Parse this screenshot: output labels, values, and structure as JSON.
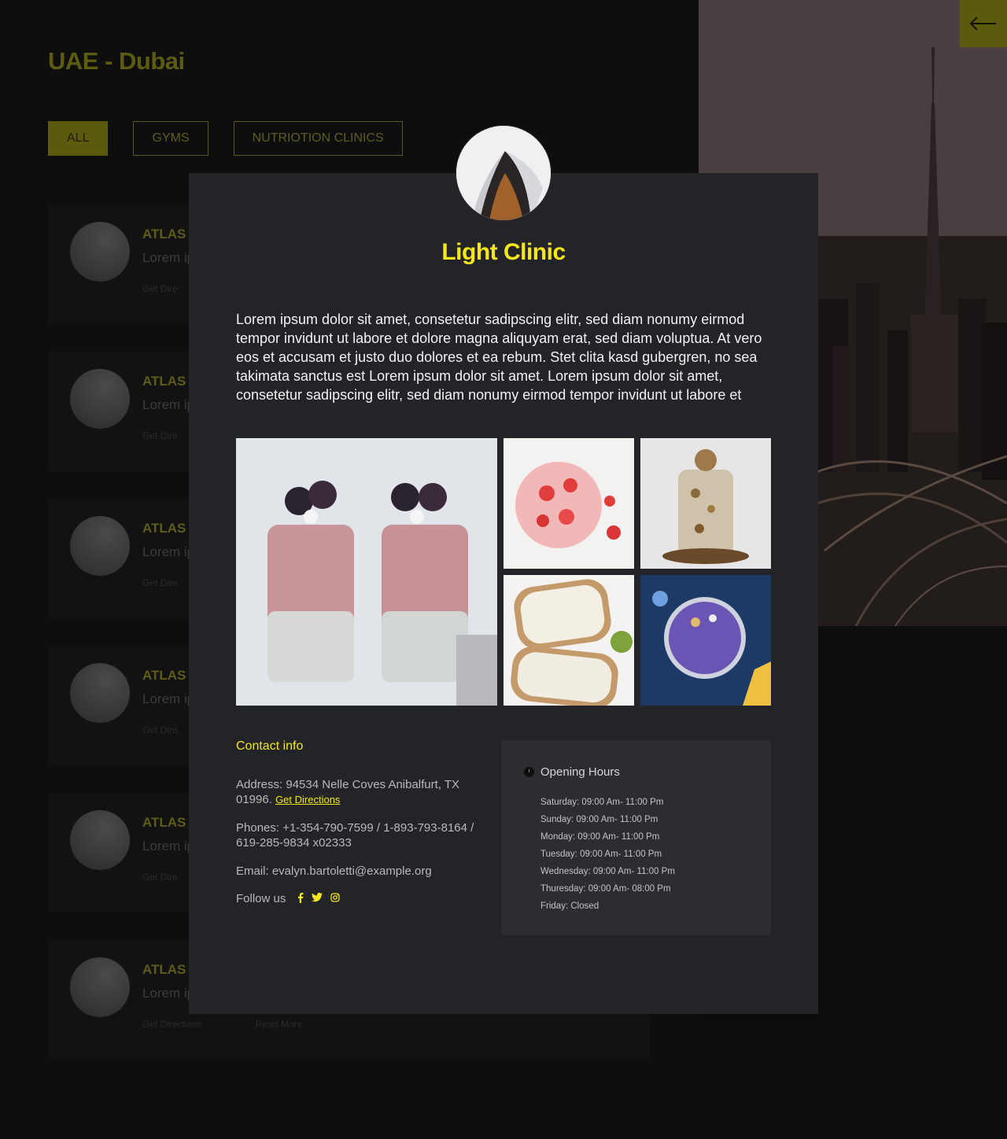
{
  "page": {
    "title": "UAE - Dubai",
    "filters": [
      "ALL",
      "GYMS",
      "NUTRIOTION CLINICS"
    ],
    "active_filter": "ALL",
    "cards": [
      {
        "title": "ATLAS G",
        "text": "Lorem ip",
        "link": "Get Dire"
      },
      {
        "title": "ATLAS G",
        "text": "Lorem ip",
        "link": "Get Dire"
      },
      {
        "title": "ATLAS G",
        "text": "Lorem ip",
        "link": "Get Dire"
      },
      {
        "title": "ATLAS G",
        "text": "Lorem ip",
        "link": "Get Dire"
      },
      {
        "title": "ATLAS G",
        "text": "Lorem ip",
        "link": "Get Dire"
      },
      {
        "title": "ATLAS G",
        "text": "Lorem ip",
        "link": "Get Directions",
        "extra": "Read More"
      }
    ]
  },
  "modal": {
    "name": "Light Clinic",
    "description": "Lorem ipsum dolor sit amet, consetetur sadipscing elitr, sed diam nonumy eirmod tempor invidunt ut labore et dolore magna aliquyam erat, sed diam voluptua. At vero eos et accusam et justo duo dolores et ea rebum. Stet clita kasd gubergren, no sea takimata sanctus est Lorem ipsum dolor sit amet. Lorem ipsum dolor sit amet, consetetur sadipscing elitr, sed diam nonumy eirmod tempor invidunt ut labore et",
    "contact": {
      "heading": "Contact info",
      "address": "Address: 94534 Nelle Coves Anibalfurt, TX 01996.",
      "directions_label": "Get Directions",
      "phones": "Phones: +1-354-790-7599 / 1-893-793-8164 / 619-285-9834 x02333",
      "email": "Email: evalyn.bartoletti@example.org",
      "follow_label": "Follow us",
      "social_icons": [
        "facebook-icon",
        "twitter-icon",
        "instagram-icon"
      ]
    },
    "hours": {
      "heading": "Opening Hours",
      "days": [
        "Saturday: 09:00 Am- 11:00 Pm",
        "Sunday: 09:00 Am- 11:00 Pm",
        "Monday: 09:00 Am- 11:00 Pm",
        "Tuesday: 09:00 Am- 11:00 Pm",
        "Wednesday: 09:00 Am- 11:00 Pm",
        "Thuresday: 09:00 Am- 08:00 Pm",
        "Friday: Closed"
      ]
    }
  },
  "colors": {
    "accent": "#f5e71c",
    "modal_bg": "#232428",
    "hours_bg": "#2c2d31",
    "dimmed_accent": "#5c5a0c"
  }
}
